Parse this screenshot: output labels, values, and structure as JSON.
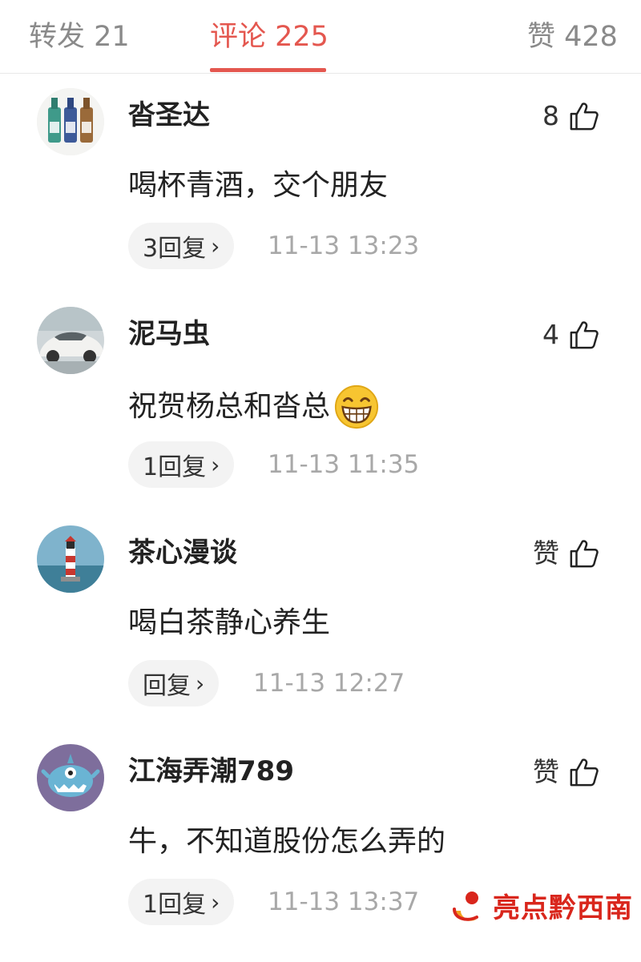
{
  "tabs": [
    {
      "label": "转发 21"
    },
    {
      "label": "评论 225"
    },
    {
      "label": "赞 428"
    }
  ],
  "colors": {
    "accent": "#e4574f",
    "muted": "#8a8a8a",
    "time": "#a8a8a8",
    "watermark": "#d9261c"
  },
  "comments": [
    {
      "username": "沓圣达",
      "likes": "8",
      "text": "喝杯青酒，交个朋友",
      "reply": "3回复",
      "time": "11-13 13:23",
      "avatar": "liquor-bottles-avatar"
    },
    {
      "username": "泥马虫",
      "likes": "4",
      "text": "祝贺杨总和沓总",
      "emoji": "grinning-face-emoji",
      "reply": "1回复",
      "time": "11-13 11:35",
      "avatar": "white-sports-car-avatar"
    },
    {
      "username": "茶心漫谈",
      "likes": "赞",
      "text": "喝白茶静心养生",
      "reply": "回复",
      "time": "11-13 12:27",
      "avatar": "lighthouse-avatar"
    },
    {
      "username": "江海弄潮789",
      "likes": "赞",
      "text": "牛，不知道股份怎么弄的",
      "reply": "1回复",
      "time": "11-13 13:37",
      "avatar": "cartoon-monster-avatar"
    }
  ],
  "icons": {
    "like": "thumbs-up-icon",
    "chevron": "chevron-right-icon"
  },
  "watermark": {
    "text": "亮点黔西南"
  }
}
